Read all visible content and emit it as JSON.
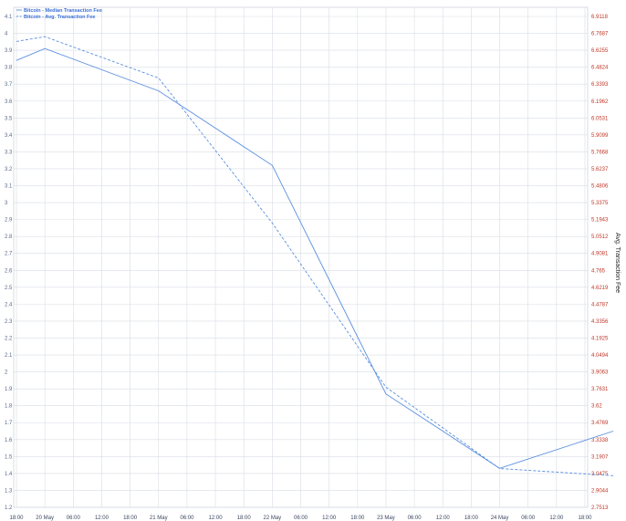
{
  "chart_data": {
    "type": "line",
    "legend": {
      "placement": "top-left",
      "entries": [
        "Bitcoin - Median Transaction Fee",
        "Bitcoin - Avg. Transaction Fee"
      ]
    },
    "x_tick_labels": [
      "18:00",
      "20 May",
      "06:00",
      "12:00",
      "18:00",
      "21 May",
      "06:00",
      "12:00",
      "18:00",
      "22 May",
      "06:00",
      "12:00",
      "18:00",
      "23 May",
      "06:00",
      "12:00",
      "18:00",
      "24 May",
      "06:00",
      "12:00",
      "18:00"
    ],
    "y_left": {
      "range": [
        1.2,
        4.1
      ],
      "tick_labels": [
        "4.1",
        "4",
        "3.9",
        "3.8",
        "3.7",
        "3.6",
        "3.5",
        "3.4",
        "3.3",
        "3.2",
        "3.1",
        "3",
        "2.9",
        "2.8",
        "2.7",
        "2.6",
        "2.5",
        "2.4",
        "2.3",
        "2.2",
        "2.1",
        "2",
        "1.9",
        "1.8",
        "1.7",
        "1.6",
        "1.5",
        "1.4",
        "1.3",
        "1.2"
      ]
    },
    "y_right": {
      "label": "Avg. Transaction Fee",
      "range": [
        2.7513,
        6.9118
      ],
      "tick_labels": [
        "6.9118",
        "6.7687",
        "6.6255",
        "6.4824",
        "6.3393",
        "6.1962",
        "6.0531",
        "5.9099",
        "5.7668",
        "5.6237",
        "5.4806",
        "5.3375",
        "5.1943",
        "5.0512",
        "4.9081",
        "4.765",
        "4.6219",
        "4.4787",
        "4.3356",
        "4.1925",
        "4.0494",
        "3.9063",
        "3.7631",
        "3.62",
        "3.4769",
        "3.3338",
        "3.1907",
        "3.0475",
        "2.9044",
        "2.7513"
      ]
    },
    "grid": true,
    "series": [
      {
        "name": "Bitcoin - Median Transaction Fee",
        "axis": "left",
        "style": "solid",
        "color": "#5b8fe0",
        "x": [
          "2024-05-19 18:00",
          "2024-05-20 00:00",
          "2024-05-21 00:00",
          "2024-05-22 00:00",
          "2024-05-23 00:00",
          "2024-05-24 00:00",
          "2024-05-25 00:00"
        ],
        "values": [
          3.84,
          3.91,
          3.66,
          3.22,
          1.87,
          1.43,
          1.65
        ]
      },
      {
        "name": "Bitcoin - Avg. Transaction Fee",
        "axis": "right",
        "style": "dashed",
        "color": "#5b8fe0",
        "x": [
          "2024-05-19 18:00",
          "2024-05-20 00:00",
          "2024-05-21 00:00",
          "2024-05-22 00:00",
          "2024-05-23 00:00",
          "2024-05-24 00:00",
          "2024-05-25 00:00"
        ],
        "values": [
          6.7,
          6.74,
          6.39,
          5.16,
          3.77,
          3.08,
          3.02
        ]
      }
    ]
  }
}
